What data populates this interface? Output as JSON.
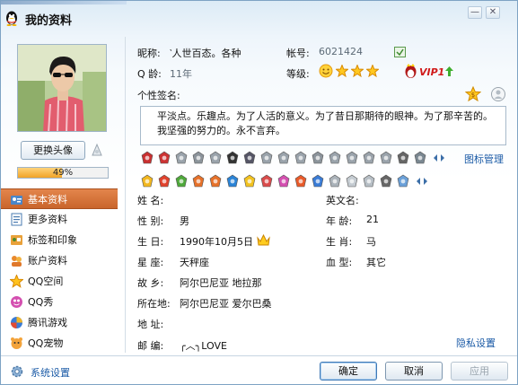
{
  "window": {
    "title": "我的资料",
    "controls": {
      "minimize": "—",
      "close": "✕"
    }
  },
  "left": {
    "change_avatar_label": "更换头像",
    "progress": {
      "value": 0.49,
      "label": "49%"
    },
    "nav": [
      {
        "label": "基本资料",
        "icon": "id-card-icon",
        "active": true
      },
      {
        "label": "更多资料",
        "icon": "document-icon"
      },
      {
        "label": "标签和印象",
        "icon": "tag-icon"
      },
      {
        "label": "账户资料",
        "icon": "account-icon"
      },
      {
        "label": "QQ空间",
        "icon": "star-icon"
      },
      {
        "label": "QQ秀",
        "icon": "qqshow-icon"
      },
      {
        "label": "腾讯游戏",
        "icon": "game-icon"
      },
      {
        "label": "QQ宠物",
        "icon": "pet-icon"
      }
    ]
  },
  "profile": {
    "nickname_label": "昵称:",
    "nickname_value": "‵人世百态。各种",
    "account_label": "帐号:",
    "account_value": "6021424",
    "qage_label": "Q 龄:",
    "qage_value": "11年",
    "level_label": "等级:",
    "vip_label": "VIP1",
    "signature_label": "个性签名:",
    "signature_text": "平淡点。乐趣点。为了人活的意义。为了昔日那期待的眼神。为了那辛苦的。我坚强的努力的。永不言弃。",
    "icon_manage_label": "图标管理",
    "privacy_label": "隐私设置"
  },
  "fields": {
    "name": {
      "label": "姓    名:",
      "value": ""
    },
    "english_name": {
      "label": "英文名:",
      "value": ""
    },
    "gender": {
      "label": "性    别:",
      "value": "男"
    },
    "age": {
      "label": "年    龄:",
      "value": "21"
    },
    "birthday": {
      "label": "生    日:",
      "value": "1990年10月5日"
    },
    "zodiac": {
      "label": "生    肖:",
      "value": "马"
    },
    "constellation": {
      "label": "星    座:",
      "value": "天秤座"
    },
    "blood": {
      "label": "血    型:",
      "value": "其它"
    },
    "hometown": {
      "label": "故    乡:",
      "value": "阿尔巴尼亚  地拉那"
    },
    "location": {
      "label": "所在地:",
      "value": "阿尔巴尼亚  爱尔巴桑"
    },
    "address": {
      "label": "地    址:",
      "value": ""
    },
    "postcode": {
      "label": "邮    编:",
      "value": "╭︿╮LOVE"
    }
  },
  "footer": {
    "settings_label": "系统设置",
    "ok_label": "确定",
    "cancel_label": "取消",
    "apply_label": "应用"
  },
  "colors": {
    "nav_active": "#d0703a",
    "link": "#1a5aa6",
    "progress_fill": "#f0a326"
  }
}
